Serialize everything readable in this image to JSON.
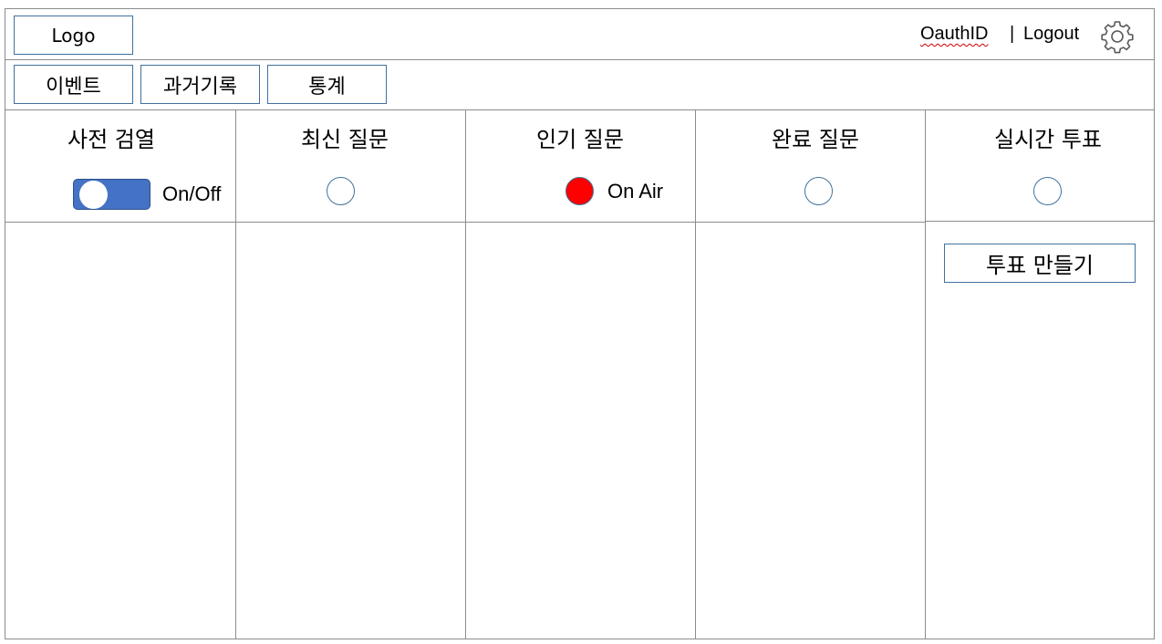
{
  "header": {
    "logo_label": "Logo",
    "user_id": "OauthID",
    "separator": "|",
    "logout_label": "Logout",
    "settings_icon": "gear-icon"
  },
  "nav": {
    "tabs": [
      {
        "label": "이벤트"
      },
      {
        "label": "과거기록"
      },
      {
        "label": "통계"
      }
    ]
  },
  "columns": [
    {
      "title": "사전 검열",
      "control": "toggle",
      "control_label": "On/Off",
      "toggle_on": true
    },
    {
      "title": "최신 질문",
      "control": "radio",
      "selected": false
    },
    {
      "title": "인기 질문",
      "control": "radio",
      "selected": true,
      "control_label": "On Air",
      "indicator_color": "#ff0000"
    },
    {
      "title": "완료 질문",
      "control": "radio",
      "selected": false
    },
    {
      "title": "실시간 투표",
      "control": "radio",
      "selected": false
    }
  ],
  "poll": {
    "create_button_label": "투표 만들기"
  },
  "colors": {
    "accent": "#4472c4",
    "border": "#41719c",
    "on_air": "#ff0000",
    "grid": "#8c8c8c"
  }
}
